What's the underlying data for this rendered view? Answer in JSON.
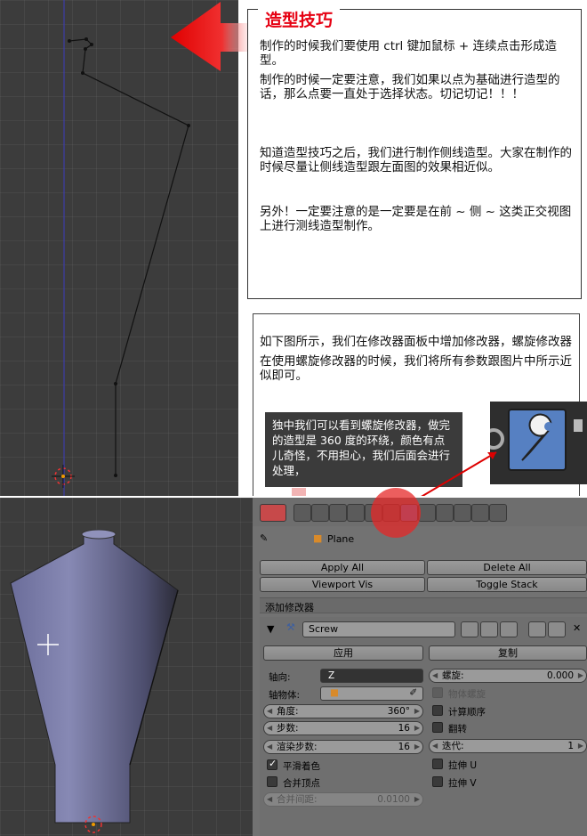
{
  "tip": {
    "title": "造型技巧",
    "p1": "制作的时候我们要使用 ctrl 键加鼠标 + 连续点击形成造型。",
    "p2": "制作的时候一定要注意，我们如果以点为基础进行造型的话，那么点要一直处于选择状态。切记切记！！！",
    "p3": "知道造型技巧之后，我们进行制作侧线造型。大家在制作的时候尽量让侧线造型跟左面图的效果相近似。",
    "p4": "另外！一定要注意的是一定要是在前 ~ 侧 ~ 这类正交视图上进行测线造型制作。"
  },
  "box2": {
    "p1": "如下图所示，我们在修改器面板中增加修改器，螺旋修改器",
    "p2": "在使用螺旋修改器的时候，我们将所有参数跟图片中所示近似即可。",
    "note": "独中我们可以看到螺旋修改器，做完的造型是 360 度的环绕，颜色有点儿奇怪，不用担心，我们后面会进行处理，"
  },
  "panel": {
    "object_name": "Plane",
    "apply_all": "Apply All",
    "delete_all": "Delete All",
    "viewport_vis": "Viewport Vis",
    "toggle_stack": "Toggle Stack",
    "add_modifier": "添加修改器",
    "modifier_name": "Screw",
    "apply": "应用",
    "copy": "复制",
    "axis_label": "轴向:",
    "axis_value": "Z",
    "axis_object_label": "轴物体:",
    "angle_label": "角度:",
    "angle_value": "360°",
    "steps_label": "步数:",
    "steps_value": "16",
    "render_steps_label": "渲染步数:",
    "render_steps_value": "16",
    "smooth_shading": "平滑着色",
    "merge_vertices": "合并顶点",
    "merge_distance_label": "合并间距:",
    "merge_distance_value": "0.0100",
    "screw_label": "螺旋:",
    "screw_value": "0.000",
    "object_screw": "物体螺旋",
    "calc_order": "计算顺序",
    "flip": "翻转",
    "iterations_label": "迭代:",
    "iterations_value": "1",
    "stretch_u": "拉伸 U",
    "stretch_v": "拉伸 V"
  },
  "colors": {
    "accent_red": "#e60012",
    "selected_blue": "#5680c2",
    "viewport_bg": "#3c3c3c",
    "panel_bg": "#727272"
  }
}
